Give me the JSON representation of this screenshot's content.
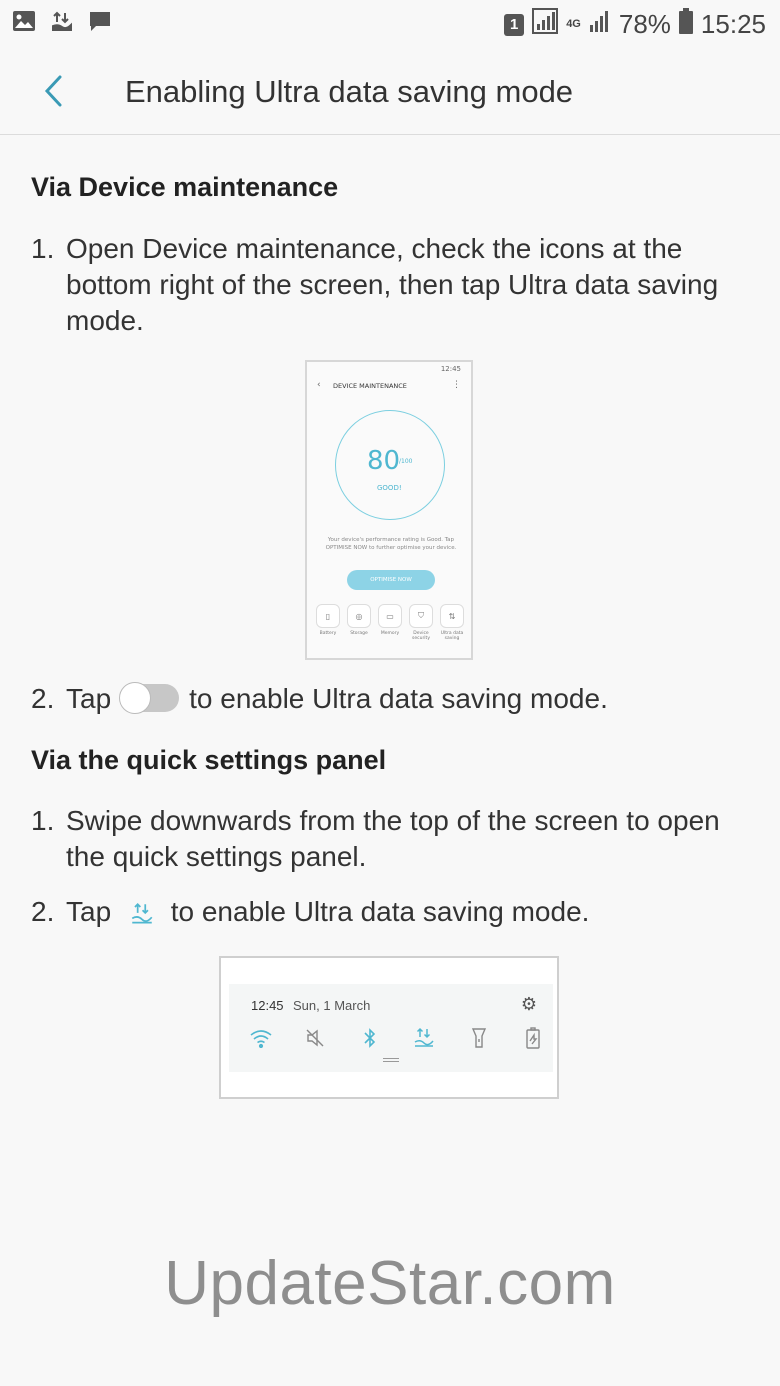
{
  "status_bar": {
    "sim_label": "1",
    "network": "4G",
    "battery": "78%",
    "time": "15:25"
  },
  "header": {
    "title": "Enabling Ultra data saving mode"
  },
  "sections": {
    "device_maintenance": {
      "heading": "Via Device maintenance",
      "step1_num": "1.",
      "step1_text": "Open Device maintenance, check the icons at the bottom right of the screen, then tap Ultra data saving mode.",
      "step2_num": "2.",
      "step2_before": "Tap",
      "step2_after": "to enable Ultra data saving mode."
    },
    "quick_panel": {
      "heading": "Via the quick settings panel",
      "step1_num": "1.",
      "step1_text": "Swipe downwards from the top of the screen to open the quick settings panel.",
      "step2_num": "2.",
      "step2_before": "Tap",
      "step2_after": "to enable Ultra data saving mode."
    }
  },
  "mock_device_maintenance": {
    "status": "12:45",
    "title": "DEVICE MAINTENANCE",
    "score": "80",
    "score_of": "/100",
    "rating": "GOOD!",
    "description": "Your device's performance rating is Good. Tap OPTIMISE NOW to further optimise your device.",
    "button": "OPTIMISE NOW",
    "icons": [
      {
        "label": "Battery"
      },
      {
        "label": "Storage"
      },
      {
        "label": "Memory"
      },
      {
        "label": "Device security"
      },
      {
        "label": "Ultra data saving"
      }
    ]
  },
  "mock_quick_panel": {
    "time": "12:45",
    "date": "Sun, 1 March"
  },
  "watermark": "UpdateStar.com",
  "colors": {
    "accent": "#4fb7d0",
    "back_arrow": "#3a9ab5"
  }
}
